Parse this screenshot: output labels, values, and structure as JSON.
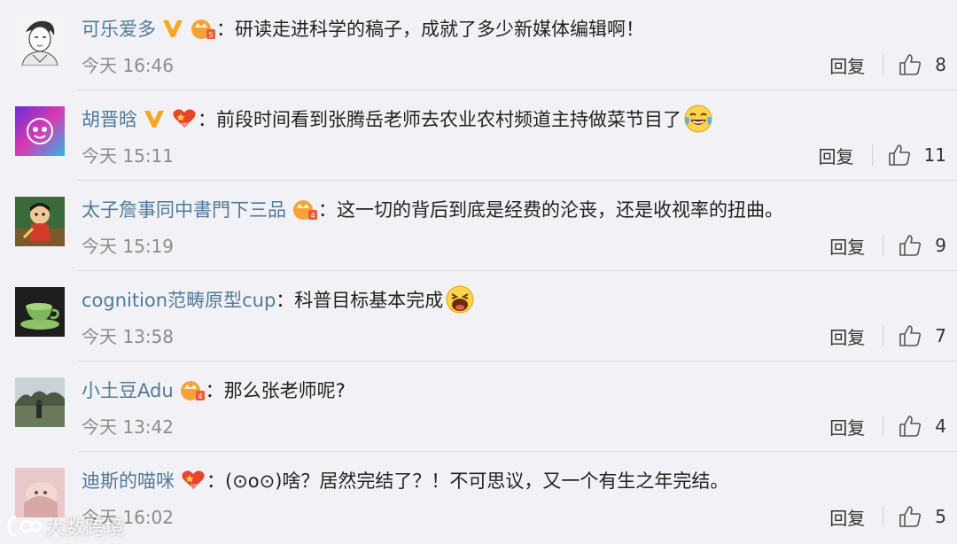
{
  "comments": [
    {
      "username": "可乐爱多",
      "badges": [
        "verified-v-icon",
        "member-crown-icon"
      ],
      "colon": "：",
      "text": "研读走进科学的稿子，成就了多少新媒体编辑啊！",
      "time": "今天 16:46",
      "reply_label": "回复",
      "likes": "8"
    },
    {
      "username": "胡晋晗",
      "badges": [
        "verified-v-icon",
        "vip7-heart-icon"
      ],
      "colon": "：",
      "text": "前段时间看到张腾岳老师去农业农村频道主持做菜节目了",
      "emoji": "tears-of-joy-emoji",
      "time": "今天 15:11",
      "reply_label": "回复",
      "likes": "11"
    },
    {
      "username": "太子詹事同中書門下三品",
      "badges": [
        "member-crown-icon"
      ],
      "colon": "：",
      "text": "这一切的背后到底是经费的沦丧，还是收视率的扭曲。",
      "time": "今天 15:19",
      "reply_label": "回复",
      "likes": "9"
    },
    {
      "username": "cognition范畴原型cup",
      "badges": [],
      "colon": "：",
      "text": "科普目标基本完成",
      "emoji": "laughing-emoji",
      "time": "今天 13:58",
      "reply_label": "回复",
      "likes": "7"
    },
    {
      "username": "小土豆Adu",
      "badges": [
        "member-crown-icon"
      ],
      "colon": "：",
      "text": "那么张老师呢?",
      "time": "今天 13:42",
      "reply_label": "回复",
      "likes": "4"
    },
    {
      "username": "迪斯的喵咪",
      "badges": [
        "vip5-heart-icon"
      ],
      "colon": "：",
      "text": "(⊙o⊙)啥？居然完结了？！不可思议，又一个有生之年完结。",
      "time": "今天 16:02",
      "reply_label": "回复",
      "likes": "5"
    }
  ],
  "watermark": {
    "text": "大数跨境",
    "icon": "watermark-logo-icon"
  },
  "colors": {
    "background": "#f2f2f6",
    "username": "#4f7a9a",
    "body_text": "#222222",
    "time_text": "#8c8c8c",
    "verified": "#f5a623",
    "member": "#f6a23a",
    "vip_heart": "#e8452a"
  }
}
